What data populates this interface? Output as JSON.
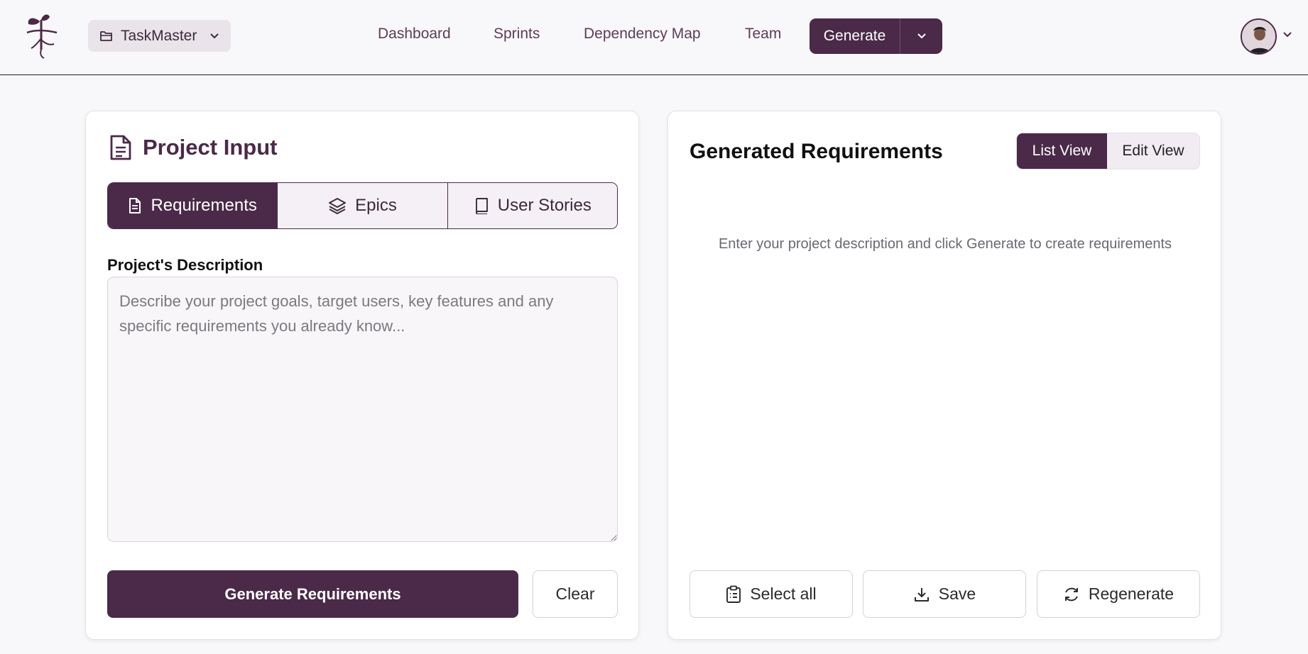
{
  "header": {
    "project_name": "TaskMaster",
    "nav": [
      {
        "label": "Dashboard"
      },
      {
        "label": "Sprints"
      },
      {
        "label": "Dependency Map"
      },
      {
        "label": "Team"
      }
    ],
    "generate_label": "Generate"
  },
  "left": {
    "title": "Project Input",
    "tabs": [
      {
        "label": "Requirements",
        "icon": "document-icon",
        "active": true
      },
      {
        "label": "Epics",
        "icon": "layers-icon",
        "active": false
      },
      {
        "label": "User Stories",
        "icon": "book-icon",
        "active": false
      }
    ],
    "description_label": "Project's Description",
    "description_value": "",
    "description_placeholder": "Describe your project goals, target users, key features and any specific requirements you already know...",
    "generate_button": "Generate Requirements",
    "clear_button": "Clear"
  },
  "right": {
    "title": "Generated Requirements",
    "view_toggle": {
      "list": "List View",
      "edit": "Edit View",
      "selected": "List View"
    },
    "empty_message": "Enter your project description and click Generate to create requirements",
    "actions": {
      "select_all": "Select all",
      "save": "Save",
      "regenerate": "Regenerate"
    }
  },
  "colors": {
    "accent": "#4a2a48",
    "background": "#f8f7f9",
    "tab_inactive": "#f4f0f5"
  }
}
